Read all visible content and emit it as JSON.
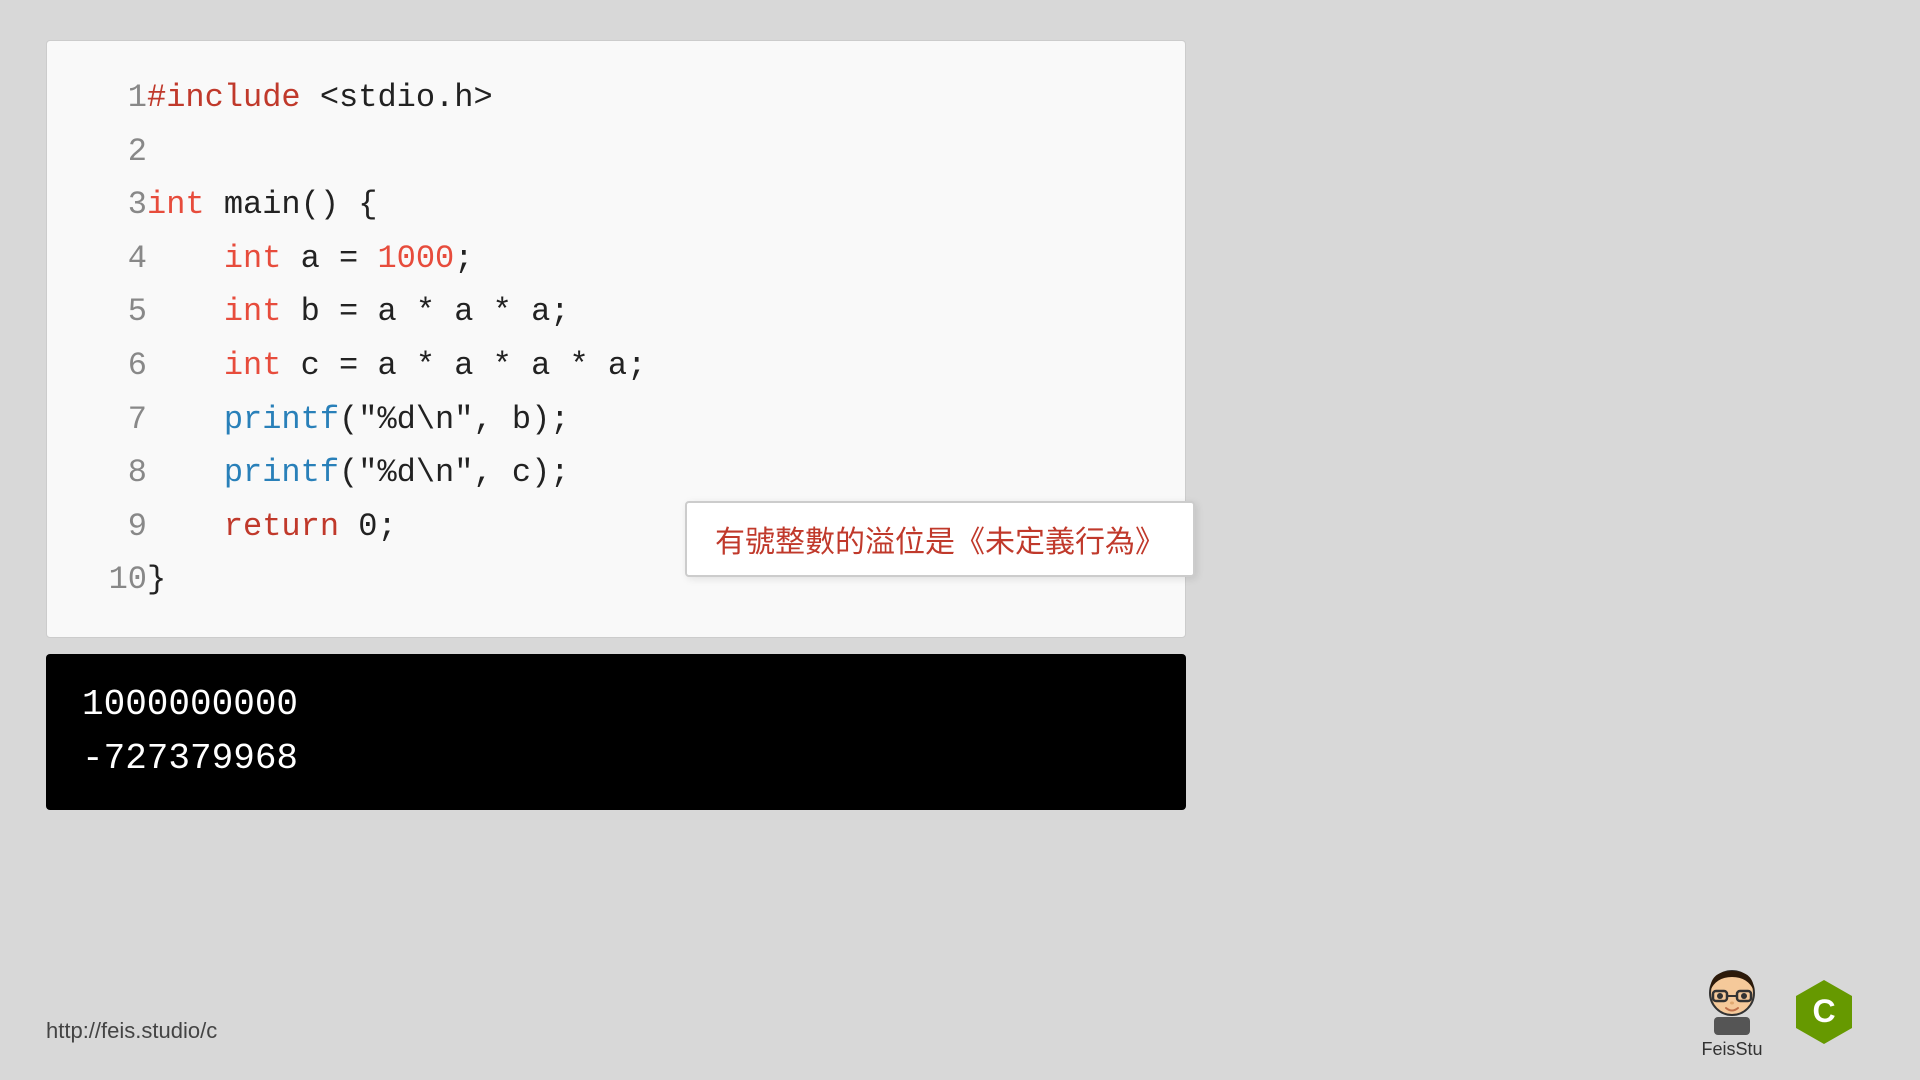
{
  "page": {
    "background": "#d8d8d8"
  },
  "code": {
    "lines": [
      {
        "num": "1",
        "tokens": [
          {
            "text": "#include ",
            "class": "kw-include"
          },
          {
            "text": "<stdio.h>",
            "class": "plain"
          }
        ]
      },
      {
        "num": "2",
        "tokens": []
      },
      {
        "num": "3",
        "tokens": [
          {
            "text": "int",
            "class": "kw-int"
          },
          {
            "text": " main() {",
            "class": "plain"
          }
        ]
      },
      {
        "num": "4",
        "tokens": [
          {
            "text": "    ",
            "class": "plain"
          },
          {
            "text": "int",
            "class": "kw-int"
          },
          {
            "text": " a = ",
            "class": "plain"
          },
          {
            "text": "1000",
            "class": "num"
          },
          {
            "text": ";",
            "class": "plain"
          }
        ]
      },
      {
        "num": "5",
        "tokens": [
          {
            "text": "    ",
            "class": "plain"
          },
          {
            "text": "int",
            "class": "kw-int"
          },
          {
            "text": " b = a * a * a;",
            "class": "plain"
          }
        ]
      },
      {
        "num": "6",
        "tokens": [
          {
            "text": "    ",
            "class": "plain"
          },
          {
            "text": "int",
            "class": "kw-int"
          },
          {
            "text": " c = a * a * a * a;",
            "class": "plain"
          }
        ]
      },
      {
        "num": "7",
        "tokens": [
          {
            "text": "    ",
            "class": "plain"
          },
          {
            "text": "printf",
            "class": "kw-printf"
          },
          {
            "text": "(\"%d\\n\", b);",
            "class": "plain"
          }
        ]
      },
      {
        "num": "8",
        "tokens": [
          {
            "text": "    ",
            "class": "plain"
          },
          {
            "text": "printf",
            "class": "kw-printf"
          },
          {
            "text": "(\"%d\\n\", c);",
            "class": "plain"
          }
        ]
      },
      {
        "num": "9",
        "tokens": [
          {
            "text": "    ",
            "class": "plain"
          },
          {
            "text": "return",
            "class": "kw-return"
          },
          {
            "text": " 0;",
            "class": "plain"
          }
        ]
      },
      {
        "num": "10",
        "tokens": [
          {
            "text": "}",
            "class": "plain"
          }
        ]
      }
    ],
    "annotation": "有號整數的溢位是《未定義行為》"
  },
  "terminal": {
    "lines": [
      "1000000000",
      "-727379968"
    ]
  },
  "footer": {
    "url": "http://feis.studio/c"
  },
  "logo": {
    "feis_label": "FeisStu"
  }
}
